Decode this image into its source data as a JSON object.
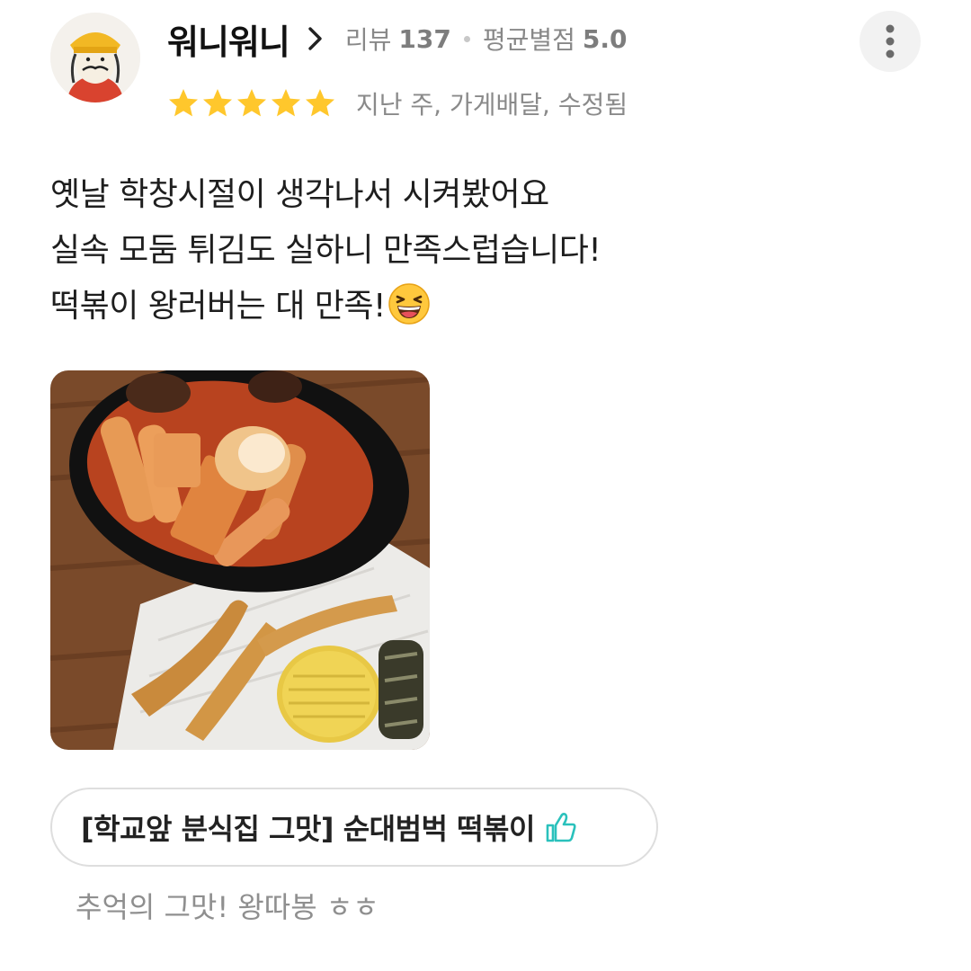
{
  "reviewer": {
    "name": "워니워니",
    "review_label": "리뷰",
    "review_count": "137",
    "avg_label": "평균별점",
    "avg_rating": "5.0"
  },
  "rating": {
    "stars": 5,
    "max": 5,
    "meta": "지난 주, 가게배달, 수정됨"
  },
  "review": {
    "lines": [
      "옛날 학창시절이 생각나서 시켜봤어요",
      "실속 모둠 튀김도 실하니 만족스럽습니다!",
      "떡볶이 왕러버는 대 만족!"
    ],
    "emoji": "laughing-face"
  },
  "menu": {
    "item_label": "[학교앞 분식집 그맛] 순대범벅 떡볶이",
    "comment": "추억의 그맛! 왕따봉 ㅎㅎ"
  },
  "colors": {
    "star": "#FFC72C",
    "thumb_icon": "#2AC1BC",
    "muted_text": "#8a8a8a"
  },
  "icons": {
    "chevron": "chevron-right-icon",
    "more": "more-vertical-icon",
    "thumb": "thumbs-up-icon"
  }
}
